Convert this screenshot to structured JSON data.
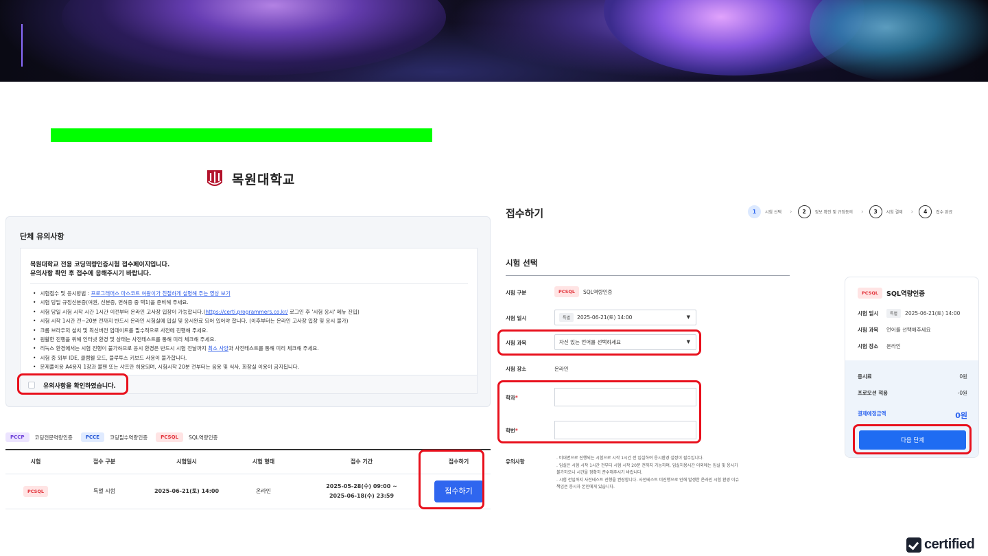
{
  "university": {
    "name": "목원대학교"
  },
  "notice": {
    "title": "단체 유의사항",
    "head_line1": "목원대학교 전용 코딩역량인증시험 접수페이지입니다.",
    "head_line2": "유의사항 확인 후 접수에 응해주시기 바랍니다.",
    "items": [
      {
        "text": "시험접수 및 응시방법 : ",
        "link": "프로그래머스 마스코트 여왕이가 친절하게 설명해 주는 영상 보기"
      },
      {
        "text": "시험 당일 규정신분증(여권, 신분증, 면허증 중 택1)을 준비해 주세요."
      },
      {
        "text": "시험 당일 시험 시작 시간 1시간 이전부터 온라인 고사장 입장이 가능합니다.(",
        "link": "https://certi.programmers.co.kr/",
        "after": " 로그인 후 '시험 응시' 메뉴 진입)"
      },
      {
        "text": "시험 시작 1시간 전~20분 전까지 반드시 온라인 시험실에 입실 및 응시완료 되어 있어야 합니다. (이후부터는 온라인 고사장 입장 및 응시 불가)"
      },
      {
        "text": "크롬 브라우저 설치 및 최신버전 업데이트를 필수적으로 사전에 진행해 주세요."
      },
      {
        "text": "원활한 진행을 위해 인터넷 환경 및 상태는 사전테스트를 통해 미리 체크해 주세요."
      },
      {
        "text": "리눅스 환경에서는 시험 진행이 불가하므로 응시 환경은 반드시 시험 전날까지 ",
        "link": "최소 사양",
        "after": "과 사전테스트를 통해 미리 체크해 주세요."
      },
      {
        "text": "시험 중 외부 IDE, 클램쉘 모드, 블루투스 키보드 사용이 불가합니다."
      },
      {
        "text": "문제풀이용 A4용지 1장과 볼펜 또는 샤프만 허용되며, 시험시작 20분 전부터는 음용 및 식사, 화장실 이용이 금지됩니다."
      }
    ],
    "confirm_label": "유의사항을 확인하였습니다."
  },
  "exam_tags": [
    {
      "code": "PCCP",
      "label": "코딩전문역량인증"
    },
    {
      "code": "PCCE",
      "label": "코딩필수역량인증"
    },
    {
      "code": "PCSQL",
      "label": "SQL역량인증"
    }
  ],
  "exam_table": {
    "headers": [
      "시험",
      "접수 구분",
      "시험일시",
      "시험 형태",
      "접수 기간",
      "접수하기"
    ],
    "row": {
      "exam": "PCSQL",
      "type": "특별 시험",
      "datetime": "2025-06-21(토) 14:00",
      "format": "온라인",
      "period_start": "2025-05-28(수) 09:00 ~",
      "period_end": "2025-06-18(수) 23:59",
      "button": "접수하기"
    }
  },
  "registration": {
    "title": "접수하기",
    "steps": [
      {
        "num": "1",
        "label": "시험 선택"
      },
      {
        "num": "2",
        "label": "정보 확인 및 규정동의"
      },
      {
        "num": "3",
        "label": "시험 결제"
      },
      {
        "num": "4",
        "label": "접수 완료"
      }
    ],
    "section_title": "시험 선택",
    "fields": {
      "category_label": "시험 구분",
      "category_tag": "PCSQL",
      "category_value": "SQL역량인증",
      "date_label": "시험 일시",
      "date_tag": "특별",
      "date_value": "2025-06-21(토) 14:00",
      "subject_label": "시험 과목",
      "subject_placeholder": "자신 있는 언어를 선택하세요",
      "place_label": "시험 장소",
      "place_value": "온라인",
      "major_label": "학과",
      "student_id_label": "학번",
      "required_mark": "*",
      "notes_label": "유의사항"
    },
    "notes": [
      ". 비대면으로 진행되는 시험으로 시작 1시간 전 입실하여 응시환경 설정이 필수입니다.",
      ". 입실은 시험 시작 1시간 전부터 시험 시작 20분 전까지 가능하며, 입실허용시간 이외에는 입실 및 응시가",
      "  불가하오니 시간을 정확히 준수해주시기 바랍니다.",
      ". 시험 전일까지 사전테스트 진행을 권장합니다. 사전테스트 미진행으로 인해 발생한 온라인 시험 환경 이슈",
      "  책임은 응시자 본인에게 있습니다."
    ]
  },
  "summary": {
    "tag": "PCSQL",
    "title": "SQL역량인증",
    "date_label": "시험 일시",
    "date_tag": "특별",
    "date_value": "2025-06-21(토) 14:00",
    "subject_label": "시험 과목",
    "subject_value": "언어를 선택해주세요",
    "place_label": "시험 장소",
    "place_value": "온라인",
    "fee_label": "응시료",
    "fee_value": "0원",
    "promo_label": "프로모션 적용",
    "promo_value": "-0원",
    "total_label": "결제예정금액",
    "total_value": "0원",
    "next_button": "다음 단계"
  },
  "branding": {
    "certified": "certified"
  },
  "colors": {
    "accent": "#2f66ef",
    "highlight": "#00ff00",
    "annotation": "#e8101c"
  }
}
